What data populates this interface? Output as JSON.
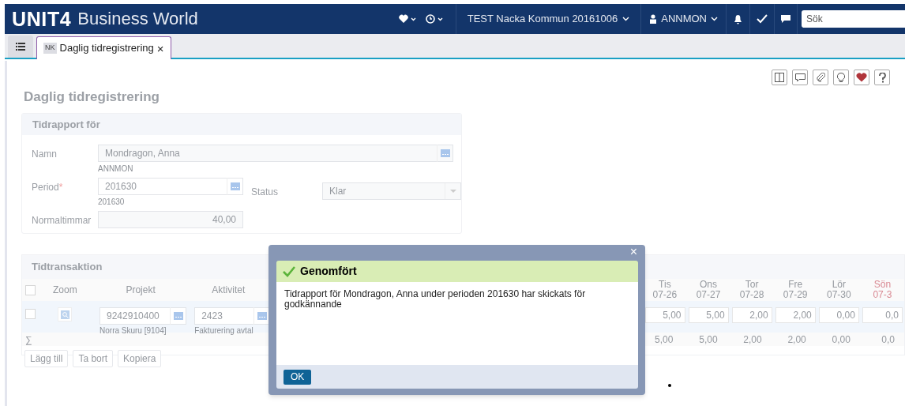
{
  "header": {
    "logo": "UNIT4",
    "product": "Business World",
    "company": "TEST Nacka Kommun 20161006",
    "user": "ANNMON",
    "search": {
      "placeholder": "Sök"
    }
  },
  "tabs": [
    {
      "badge": "NK",
      "label": "Daglig tidregistrering",
      "close": "×",
      "selected": true
    }
  ],
  "page_title": "Daglig tidregistrering",
  "report_panel": {
    "title": "Tidrapport för",
    "name": {
      "label": "Namn",
      "value": "Mondragon, Anna",
      "sub": "ANNMON"
    },
    "period": {
      "label": "Period",
      "required_mark": "*",
      "value": "201630",
      "sub": "201630"
    },
    "status": {
      "label": "Status",
      "value": "Klar"
    },
    "normal_hours": {
      "label": "Normaltimmar",
      "value": "40,00"
    }
  },
  "transactions": {
    "title": "Tidtransaktion",
    "select_all": {
      "checked": false
    },
    "columns": [
      {
        "label": "Zoom"
      },
      {
        "label": "Projekt"
      },
      {
        "label": "Aktivitet"
      }
    ],
    "days": [
      {
        "day": "Tis",
        "date": "07-26",
        "value": "5,00",
        "sum": "5,00",
        "weekend": false
      },
      {
        "day": "Ons",
        "date": "07-27",
        "value": "5,00",
        "sum": "5,00",
        "weekend": false
      },
      {
        "day": "Tor",
        "date": "07-28",
        "value": "2,00",
        "sum": "2,00",
        "weekend": false
      },
      {
        "day": "Fre",
        "date": "07-29",
        "value": "2,00",
        "sum": "2,00",
        "weekend": false
      },
      {
        "day": "Lör",
        "date": "07-30",
        "value": "0,00",
        "sum": "0,00",
        "weekend": false
      },
      {
        "day": "Sön",
        "date": "07-3",
        "value": "0,0",
        "sum": "0,0",
        "weekend": true
      }
    ],
    "row": {
      "checked": false,
      "project": "9242910400",
      "project_name": "Norra Skuru [9104]",
      "activity": "2423",
      "activity_name": "Fakturering avtal"
    },
    "sum_symbol": "∑",
    "buttons": [
      "Lägg till",
      "Ta bort",
      "Kopiera"
    ]
  },
  "dialog": {
    "close": "×",
    "title": "Genomfört",
    "message": "Tidrapport för Mondragon, Anna under perioden 201630 har skickats för godkännande",
    "ok": "OK"
  }
}
